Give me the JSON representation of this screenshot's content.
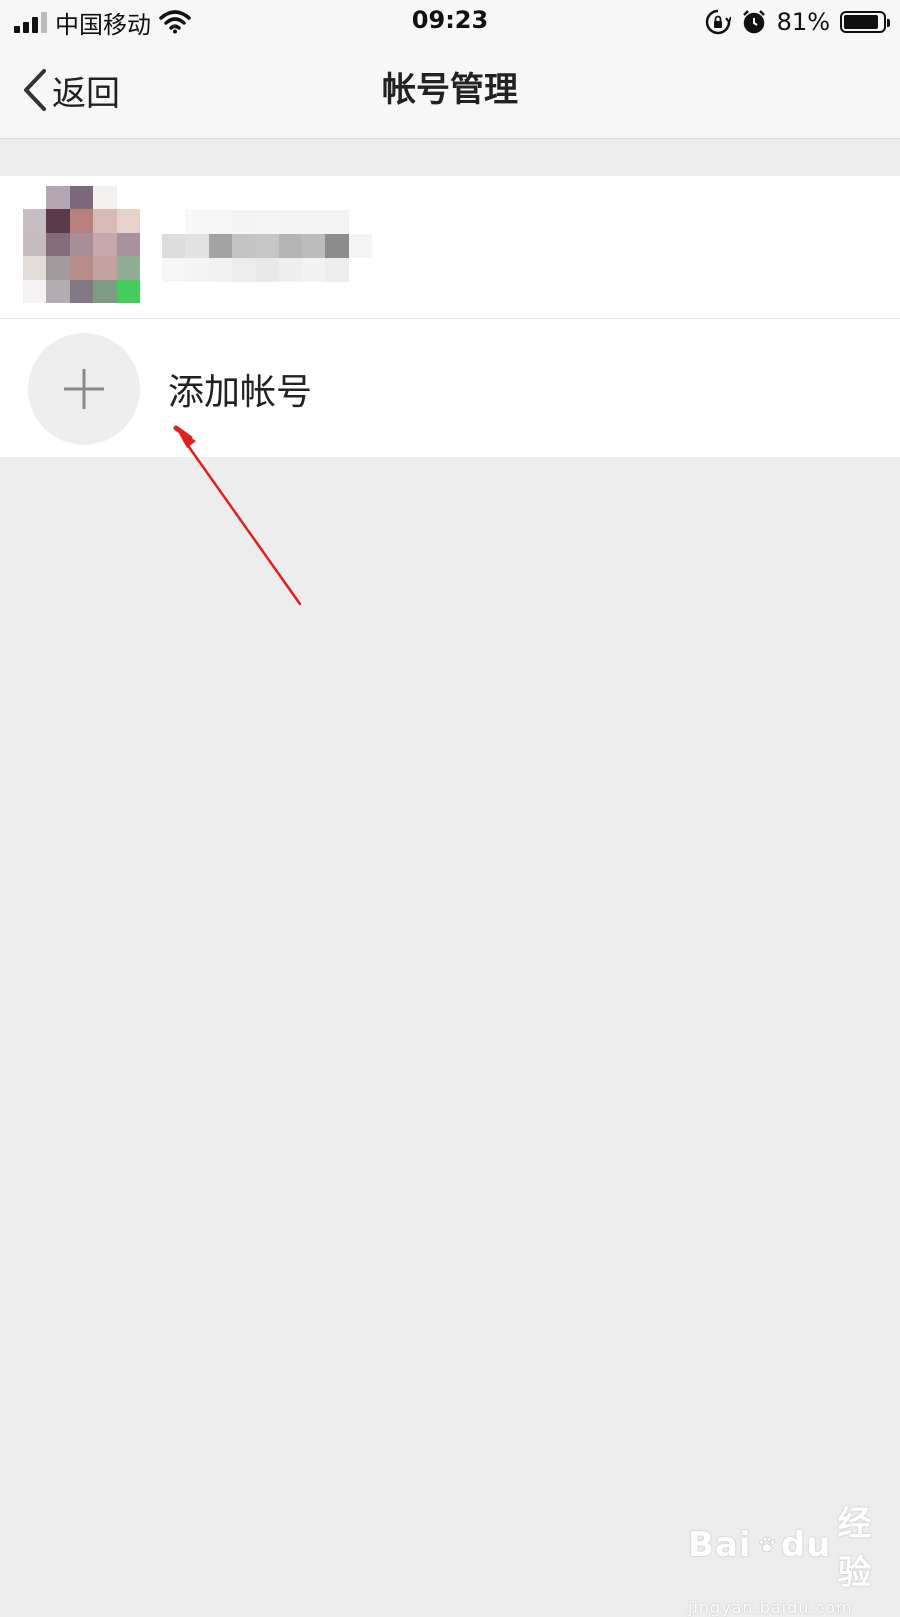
{
  "status_bar": {
    "carrier": "中国移动",
    "time": "09:23",
    "battery_percent": "81%",
    "battery_level": 0.81,
    "icons": [
      "signal-icon",
      "wifi-icon",
      "rotation-lock-icon",
      "alarm-icon",
      "battery-icon"
    ]
  },
  "nav": {
    "back_label": "返回",
    "title": "帐号管理",
    "back_icon": "chevron-left-icon"
  },
  "list": {
    "account_row": {
      "avatar_icon": "avatar-pixelated",
      "name": ""
    },
    "add_account": {
      "label": "添加帐号",
      "icon": "plus-icon"
    }
  },
  "annotation": {
    "arrow_color": "#e02020"
  },
  "watermark": {
    "brand": "Bai",
    "brand_tail": "du",
    "product": "经验",
    "url": "jingyan.baidu.com"
  },
  "colors": {
    "page_bg": "#ededed",
    "bar_bg": "#f7f7f7",
    "list_bg": "#ffffff",
    "text": "#222222"
  }
}
